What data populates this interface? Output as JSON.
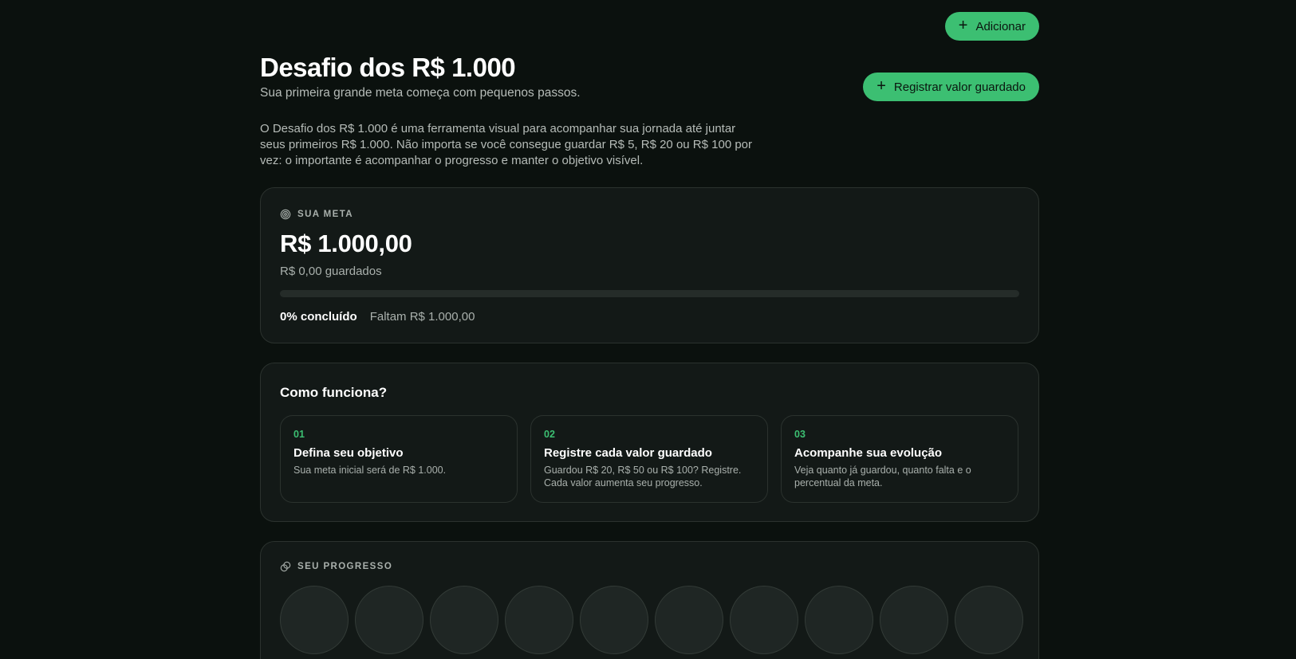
{
  "header": {
    "add_label": "Adicionar",
    "register_label": "Registrar valor guardado",
    "title": "Desafio dos R$ 1.000",
    "subtitle": "Sua primeira grande meta começa com pequenos passos.",
    "intro": "O Desafio dos R$ 1.000 é uma ferramenta visual para acompanhar sua jornada até juntar seus primeiros R$ 1.000. Não importa se você consegue guardar R$ 5, R$ 20 ou R$ 100 por vez: o importante é acompanhar o progresso e manter o objetivo visível."
  },
  "goal": {
    "eyebrow": "SUA META",
    "amount": "R$ 1.000,00",
    "saved": "R$ 0,00 guardados",
    "progress_percent": 0,
    "percent_label": "0% concluído",
    "remaining_label": "Faltam R$ 1.000,00",
    "icon": "target-icon"
  },
  "how": {
    "title": "Como funciona?",
    "steps": [
      {
        "num": "01",
        "title": "Defina seu objetivo",
        "desc": "Sua meta inicial será de R$ 1.000."
      },
      {
        "num": "02",
        "title": "Registre cada valor guardado",
        "desc": "Guardou R$ 20, R$ 50 ou R$ 100? Registre. Cada valor aumenta seu progresso."
      },
      {
        "num": "03",
        "title": "Acompanhe sua evolução",
        "desc": "Veja quanto já guardou, quanto falta e o percentual da meta."
      }
    ]
  },
  "progress": {
    "eyebrow": "SEU PROGRESSO",
    "icon": "coins-icon"
  },
  "colors": {
    "accent": "#3cbf72",
    "background": "#0b110e",
    "card": "#131917"
  }
}
